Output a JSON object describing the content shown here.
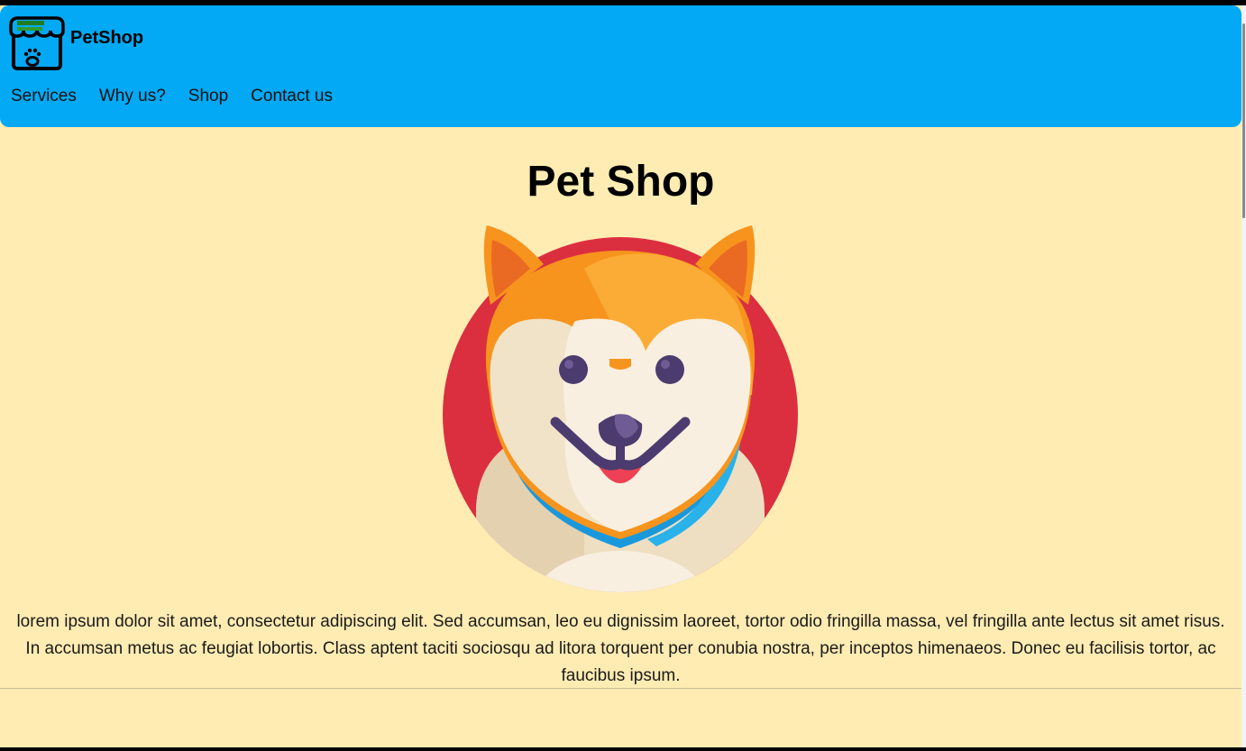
{
  "navbar": {
    "brand_name": "PetShop",
    "logo_icon": "pet-store-icon",
    "links": [
      {
        "label": "Services"
      },
      {
        "label": "Why us?"
      },
      {
        "label": "Shop"
      },
      {
        "label": "Contact us"
      }
    ]
  },
  "hero": {
    "title": "Pet Shop",
    "image_icon": "dog-face-icon",
    "description": "lorem ipsum dolor sit amet, consectetur adipiscing elit. Sed accumsan, leo eu dignissim laoreet, tortor odio fringilla massa, vel fringilla ante lectus sit amet risus. In accumsan metus ac feugiat lobortis. Class aptent taciti sociosqu ad litora torquent per conubia nostra, per inceptos himenaeos. Donec eu facilisis tortor, ac faucibus ipsum."
  },
  "colors": {
    "navbar_bg": "#03a9f4",
    "page_bg": "#ffecb3"
  }
}
